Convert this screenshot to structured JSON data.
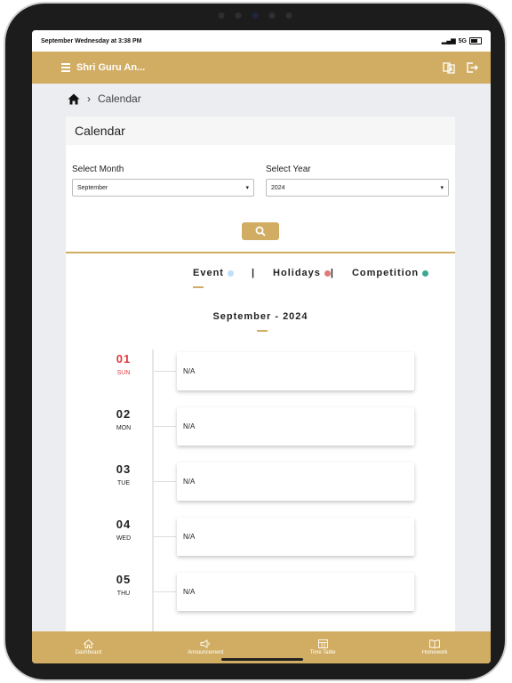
{
  "statusbar": {
    "left_text": "September Wednesday at 3:38 PM",
    "network": "5G"
  },
  "appbar": {
    "title": "Shri Guru An..."
  },
  "breadcrumb": {
    "current": "Calendar"
  },
  "card": {
    "title": "Calendar",
    "month_label": "Select Month",
    "month_value": "September",
    "year_label": "Select Year",
    "year_value": "2024"
  },
  "legend": {
    "event": "Event",
    "separator": "|",
    "holidays": "Holidays",
    "holidays_suffix": "|",
    "competition": "Competition",
    "colors": {
      "event": "#bfe0f7",
      "holidays": "#e07a7a",
      "competition": "#3aa893"
    }
  },
  "month_title": "September - 2024",
  "days": [
    {
      "num": "01",
      "name": "SUN",
      "event": "N/A",
      "highlight": "red"
    },
    {
      "num": "02",
      "name": "MON",
      "event": "N/A"
    },
    {
      "num": "03",
      "name": "TUE",
      "event": "N/A"
    },
    {
      "num": "04",
      "name": "WED",
      "event": "N/A"
    },
    {
      "num": "05",
      "name": "THU",
      "event": "N/A"
    }
  ],
  "bottom_nav": [
    {
      "label": "Dashboard",
      "icon": "home-icon"
    },
    {
      "label": "Announcement",
      "icon": "megaphone-icon"
    },
    {
      "label": "Time Table",
      "icon": "timetable-icon"
    },
    {
      "label": "Homework",
      "icon": "book-icon"
    }
  ],
  "colors": {
    "primary": "#d1ad63",
    "background": "#ecedf1",
    "accent_red": "#e0393e"
  }
}
